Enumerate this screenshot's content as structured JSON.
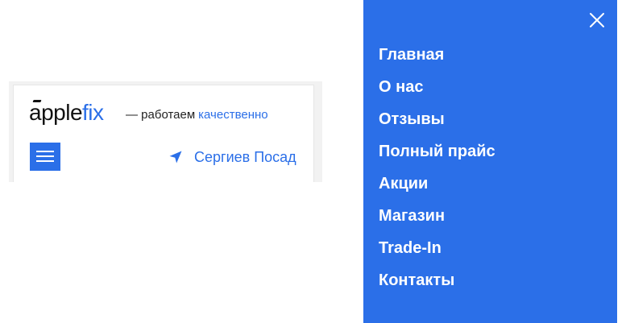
{
  "header": {
    "logo": {
      "part1": "pple",
      "part2": "fix"
    },
    "tagline": {
      "text": "— работаем",
      "accent": "качественно"
    },
    "menu_button_icon": "hamburger-icon",
    "location": {
      "icon": "navigation-arrow-icon",
      "city": "Сергиев Посад"
    }
  },
  "menu": {
    "close_icon": "close-icon",
    "items": [
      {
        "label": "Главная"
      },
      {
        "label": "О нас"
      },
      {
        "label": "Отзывы"
      },
      {
        "label": "Полный прайс"
      },
      {
        "label": "Акции"
      },
      {
        "label": "Магазин"
      },
      {
        "label": "Trade-In"
      },
      {
        "label": "Контакты"
      }
    ]
  },
  "colors": {
    "accent": "#2b6fe8",
    "text": "#222222",
    "background": "#ffffff"
  }
}
